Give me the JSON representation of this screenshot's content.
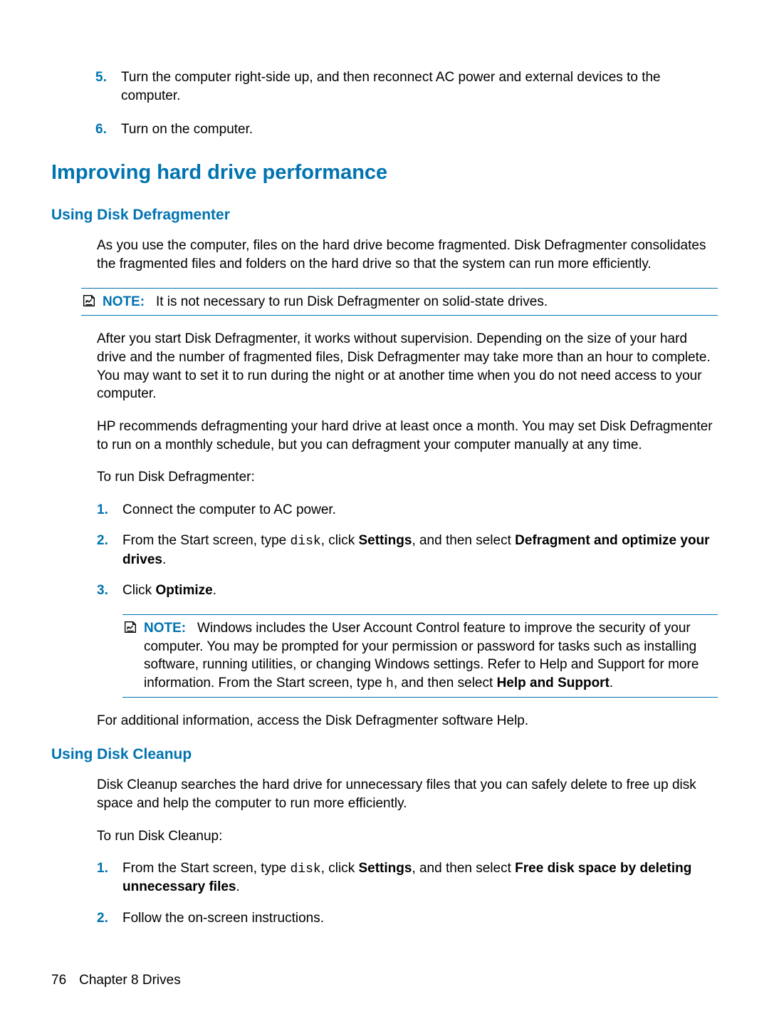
{
  "continued_steps": [
    {
      "num": "5.",
      "text": "Turn the computer right-side up, and then reconnect AC power and external devices to the computer."
    },
    {
      "num": "6.",
      "text": "Turn on the computer."
    }
  ],
  "heading1": "Improving hard drive performance",
  "section_defrag": {
    "heading": "Using Disk Defragmenter",
    "intro": "As you use the computer, files on the hard drive become fragmented. Disk Defragmenter consolidates the fragmented files and folders on the hard drive so that the system can run more efficiently.",
    "note1_label": "NOTE:",
    "note1_text": "It is not necessary to run Disk Defragmenter on solid-state drives.",
    "para2": "After you start Disk Defragmenter, it works without supervision. Depending on the size of your hard drive and the number of fragmented files, Disk Defragmenter may take more than an hour to complete. You may want to set it to run during the night or at another time when you do not need access to your computer.",
    "para3": "HP recommends defragmenting your hard drive at least once a month. You may set Disk Defragmenter to run on a monthly schedule, but you can defragment your computer manually at any time.",
    "para4": "To run Disk Defragmenter:",
    "steps": [
      {
        "num": "1.",
        "text": "Connect the computer to AC power."
      },
      {
        "num": "2.",
        "pre": "From the Start screen, type ",
        "mono": "disk",
        "mid": ", click ",
        "b1": "Settings",
        "mid2": ", and then select ",
        "b2": "Defragment and optimize your drives",
        "post": "."
      },
      {
        "num": "3.",
        "pre": "Click ",
        "b1": "Optimize",
        "post": "."
      }
    ],
    "note2_label": "NOTE:",
    "note2_pre": "Windows includes the User Account Control feature to improve the security of your computer. You may be prompted for your permission or password for tasks such as installing software, running utilities, or changing Windows settings. Refer to Help and Support for more information. From the Start screen, type ",
    "note2_mono": "h",
    "note2_mid": ", and then select ",
    "note2_b": "Help and Support",
    "note2_post": ".",
    "para5": "For additional information, access the Disk Defragmenter software Help."
  },
  "section_cleanup": {
    "heading": "Using Disk Cleanup",
    "intro": "Disk Cleanup searches the hard drive for unnecessary files that you can safely delete to free up disk space and help the computer to run more efficiently.",
    "para2": "To run Disk Cleanup:",
    "steps": [
      {
        "num": "1.",
        "pre": "From the Start screen, type ",
        "mono": "disk",
        "mid": ", click ",
        "b1": "Settings",
        "mid2": ", and then select ",
        "b2": "Free disk space by deleting unnecessary files",
        "post": "."
      },
      {
        "num": "2.",
        "text": "Follow the on-screen instructions."
      }
    ]
  },
  "footer": {
    "page": "76",
    "chapter": "Chapter 8   Drives"
  }
}
